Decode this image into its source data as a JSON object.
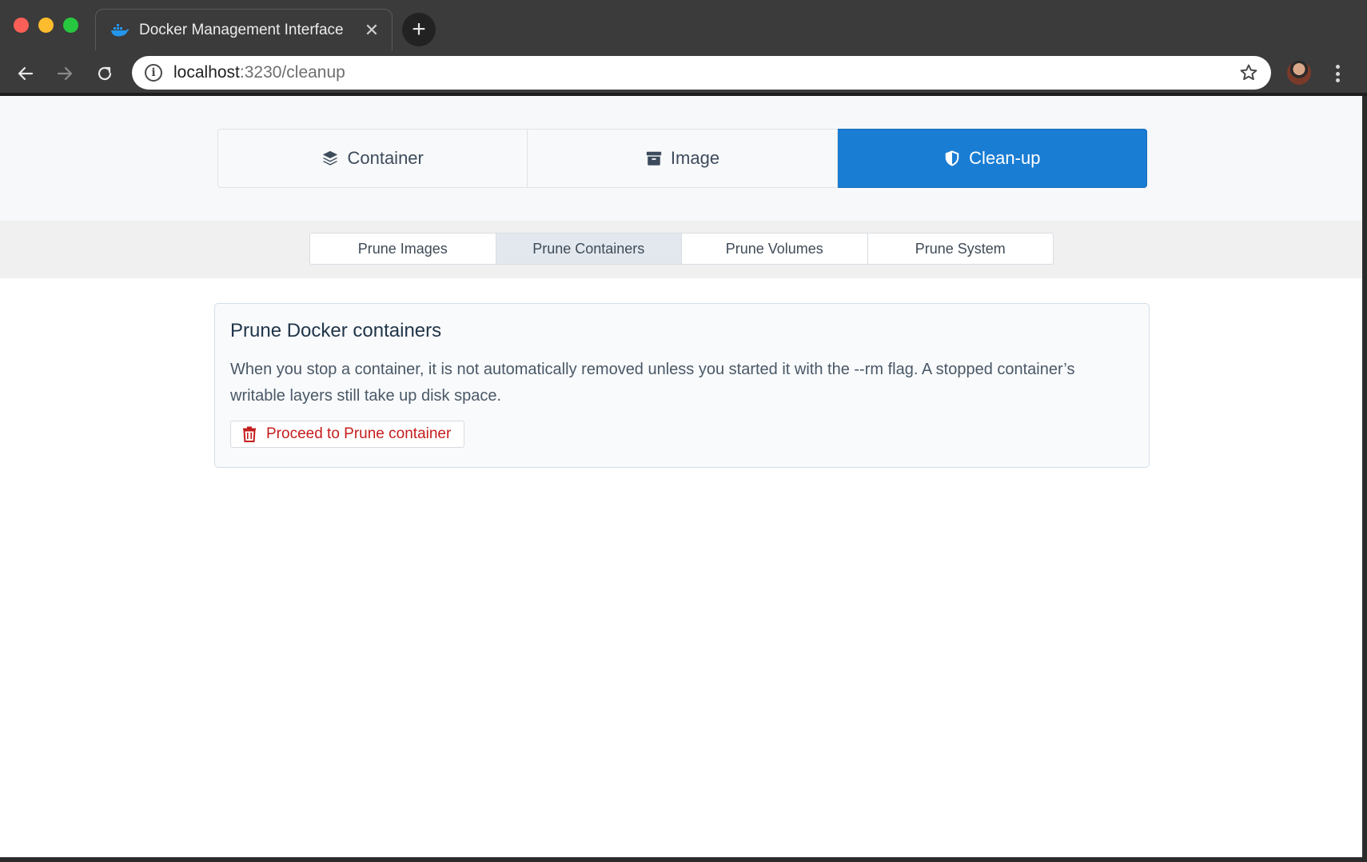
{
  "browser": {
    "tab_title": "Docker Management Interface",
    "tab_close": "✕",
    "new_tab": "+",
    "url_host": "localhost",
    "url_path": ":3230/cleanup"
  },
  "main_tabs": [
    {
      "label": "Container",
      "icon": "layers-icon",
      "active": false
    },
    {
      "label": "Image",
      "icon": "archive-icon",
      "active": false
    },
    {
      "label": "Clean-up",
      "icon": "shield-icon",
      "active": true
    }
  ],
  "sub_tabs": [
    {
      "label": "Prune Images",
      "active": false
    },
    {
      "label": "Prune Containers",
      "active": true
    },
    {
      "label": "Prune Volumes",
      "active": false
    },
    {
      "label": "Prune System",
      "active": false
    }
  ],
  "card": {
    "title": "Prune Docker containers",
    "description": "When you stop a container, it is not automatically removed unless you started it with the --rm flag. A stopped container’s writable layers still take up disk space.",
    "button_label": "Proceed to Prune container",
    "button_icon": "trash-icon"
  },
  "colors": {
    "accent": "#1a7dd4",
    "danger": "#c41d1d",
    "chrome": "#3b3b3b"
  }
}
